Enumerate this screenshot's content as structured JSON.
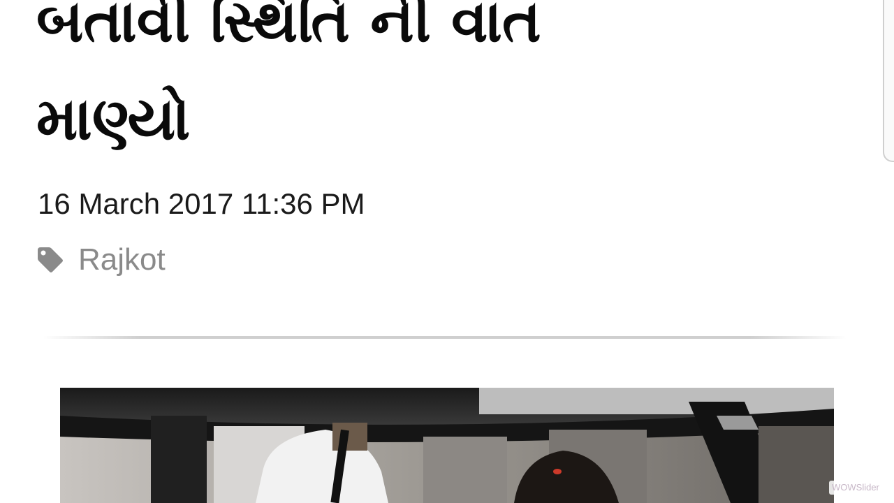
{
  "article": {
    "title_line_1": "બતાવી સ્થિતિ ની વાત",
    "title_line_2": "માણ્યો",
    "date": "16 March 2017 11:36 PM",
    "tag": "Rajkot"
  },
  "slider": {
    "badge": "WOWSlider"
  },
  "icons": {
    "tag": "tag-icon"
  },
  "colors": {
    "text": "#0a0a0a",
    "tag_text": "#8a8a8a",
    "divider": "#cfcfcf"
  }
}
